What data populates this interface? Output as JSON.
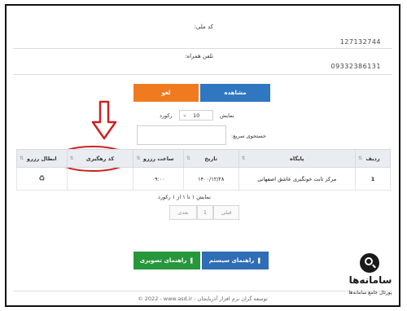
{
  "form": {
    "tracking_code_label": "کد ملی:",
    "tracking_code_value": "127132744",
    "phone_label": "تلفن همراه:",
    "phone_value": "09332386131"
  },
  "buttons": {
    "view_label": "مشاهده",
    "cancel_label": "لغو"
  },
  "table_controls": {
    "show_label": "نمایش",
    "page_size": "10",
    "records_label": "رکورد",
    "search_label": "جستجوی سریع:",
    "search_value": ""
  },
  "table": {
    "headers": [
      "ردیف",
      "پایگاه",
      "تاریخ",
      "ساعت رزرو",
      "کد رهگیری",
      "ابطال رزرو"
    ],
    "rows": [
      {
        "index": "1",
        "center": "مرکز ثابت خونگیری عاشق اصفهانی",
        "date": "۱۴۰۰/۱۲/۲۸",
        "time": "۰۹:۰۰",
        "code": "",
        "cancel_icon": "recycle-icon"
      }
    ],
    "info": "نمایش ۱ تا ۱ از ۱ رکورد",
    "prev_label": "قبلی",
    "page": "1",
    "next_label": "بعدی"
  },
  "guides": {
    "system_guide": "راهنمای سیستم",
    "visual_guide": "راهنمای تصویری"
  },
  "footer": {
    "text": "© 2022 - www.asd.ir - توسعه گران نرم افزار آذربایجان"
  },
  "watermark": {
    "brand": "سامانه‌ها",
    "tagline": "پورتال جامع سامانه‌ها"
  },
  "colors": {
    "view_button": "#2f77c0",
    "cancel_button": "#f07a1f",
    "system_guide_button": "#2f6db5",
    "visual_guide_button": "#27973c",
    "annotation_red": "#cc2222"
  }
}
